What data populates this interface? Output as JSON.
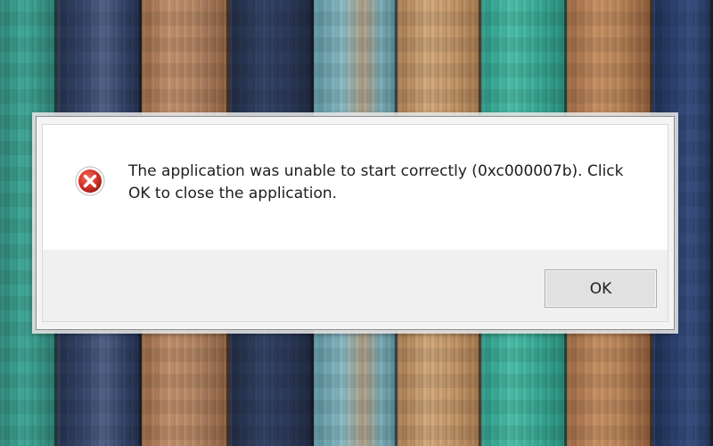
{
  "dialog": {
    "message": "The application was unable to start correctly (0xc000007b). Click OK to close the application.",
    "icon": "error-icon",
    "ok_label": "OK"
  },
  "colors": {
    "icon_red": "#c42b1c",
    "plank_colors": [
      "#3fa596",
      "#384a6e",
      "#b38462",
      "#2f3b57",
      "#6fa7b3",
      "#c79b6c",
      "#47b5a1",
      "#b47a50",
      "#2a3c64"
    ]
  }
}
